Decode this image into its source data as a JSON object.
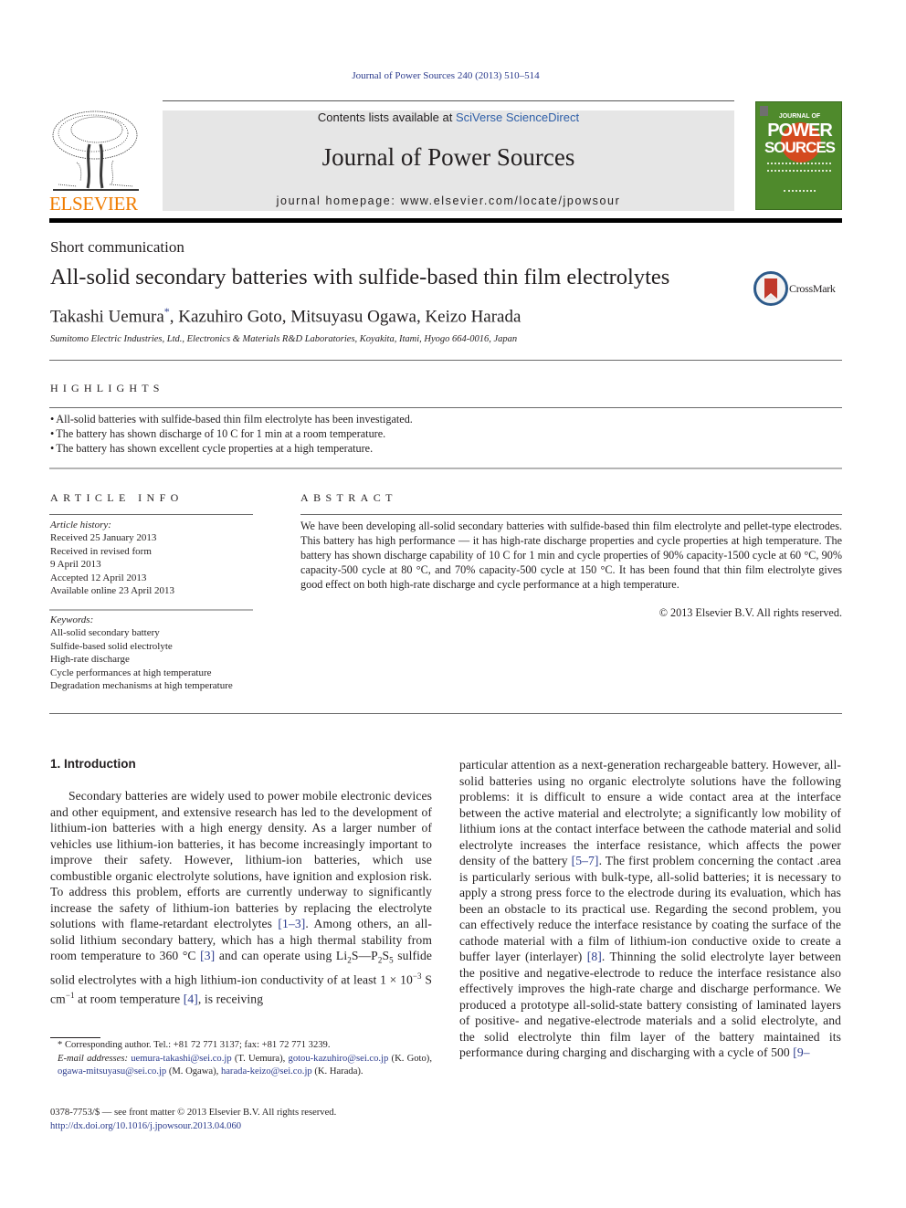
{
  "citation": "Journal of Power Sources 240 (2013) 510–514",
  "header": {
    "publisher_logo_text": "ELSEVIER",
    "contents_prefix": "Contents lists available at ",
    "contents_link": "SciVerse ScienceDirect",
    "journal_title": "Journal of Power Sources",
    "homepage": "journal homepage: www.elsevier.com/locate/jpowsour",
    "cover": {
      "line1": "JOURNAL OF",
      "line2": "POWER",
      "line3": "SOURCES"
    }
  },
  "article": {
    "type": "Short communication",
    "title": "All-solid secondary batteries with sulfide-based thin film electrolytes",
    "crossmark_label": "CrossMark",
    "authors": [
      {
        "name": "Takashi Uemura",
        "mark": "*"
      },
      {
        "name": "Kazuhiro Goto",
        "mark": ""
      },
      {
        "name": "Mitsuyasu Ogawa",
        "mark": ""
      },
      {
        "name": "Keizo Harada",
        "mark": ""
      }
    ],
    "affiliation": "Sumitomo Electric Industries, Ltd., Electronics & Materials R&D Laboratories, Koyakita, Itami, Hyogo 664-0016, Japan"
  },
  "highlights": {
    "heading": "HIGHLIGHTS",
    "items": [
      "All-solid batteries with sulfide-based thin film electrolyte has been investigated.",
      "The battery has shown discharge of 10 C for 1 min at a room temperature.",
      "The battery has shown excellent cycle properties at a high temperature."
    ]
  },
  "article_info": {
    "heading": "ARTICLE INFO",
    "history_label": "Article history:",
    "history": [
      "Received 25 January 2013",
      "Received in revised form",
      "9 April 2013",
      "Accepted 12 April 2013",
      "Available online 23 April 2013"
    ],
    "keywords_label": "Keywords:",
    "keywords": [
      "All-solid secondary battery",
      "Sulfide-based solid electrolyte",
      "High-rate discharge",
      "Cycle performances at high temperature",
      "Degradation mechanisms at high temperature"
    ]
  },
  "abstract": {
    "heading": "ABSTRACT",
    "text": "We have been developing all-solid secondary batteries with sulfide-based thin film electrolyte and pellet-type electrodes. This battery has high performance — it has high-rate discharge properties and cycle properties at high temperature. The battery has shown discharge capability of 10 C for 1 min and cycle properties of 90% capacity-1500 cycle at 60 °C, 90% capacity-500 cycle at 80 °C, and 70% capacity-500 cycle at 150 °C. It has been found that thin film electrolyte gives good effect on both high-rate discharge and cycle performance at a high temperature.",
    "copyright": "© 2013 Elsevier B.V. All rights reserved."
  },
  "body": {
    "section_heading": "1.  Introduction",
    "left": {
      "p1": "Secondary batteries are widely used to power mobile electronic devices and other equipment, and extensive research has led to the development of lithium-ion batteries with a high energy density. As a larger number of vehicles use lithium-ion batteries, it has become increasingly important to improve their safety. However, lithium-ion batteries, which use combustible organic electrolyte solutions, have ignition and explosion risk. To address this problem, efforts are currently underway to significantly increase the safety of lithium-ion batteries by replacing the electrolyte solutions with flame-retardant electrolytes ",
      "ref1": "[1–3]",
      "p2": ". Among others, an all-solid lithium secondary battery, which has a high thermal stability from room temperature to 360 °C ",
      "ref2": "[3]",
      "p3a": " and can operate using Li",
      "sub2a": "2",
      "p3b": "S—P",
      "sub2b": "2",
      "p3c": "S",
      "sub5": "5",
      "p3d": " sulfide solid electrolytes with a high lithium-ion conductivity of at least 1 × 10",
      "sup_m3": "−3",
      "p3e": " S cm",
      "sup_m1": "−1",
      "p3f": " at room temperature ",
      "ref3": "[4]",
      "p4": ", is receiving"
    },
    "right": {
      "p1": "particular attention as a next-generation rechargeable battery. However, all-solid batteries using no organic electrolyte solutions have the following problems: it is difficult to ensure a wide contact area at the interface between the active material and electrolyte; a significantly low mobility of lithium ions at the contact interface between the cathode material and solid electrolyte increases the interface resistance, which affects the power density of the battery ",
      "ref1": "[5–7]",
      "p2": ". The first problem concerning the contact .area is particularly serious with bulk-type, all-solid batteries; it is necessary to apply a strong press force to the electrode during its evaluation, which has been an obstacle to its practical use. Regarding the second problem, you can effectively reduce the interface resistance by coating the surface of the cathode material with a film of lithium-ion conductive oxide to create a buffer layer (interlayer) ",
      "ref2": "[8]",
      "p3": ". Thinning the solid electrolyte layer between the positive and negative-electrode to reduce the interface resistance also effectively improves the high-rate charge and discharge performance. We produced a prototype all-solid-state battery consisting of laminated layers of positive- and negative-electrode materials and a solid electrolyte, and the solid electrolyte thin film layer of the battery maintained its performance during charging and discharging with a cycle of 500 ",
      "ref3": "[9–"
    }
  },
  "footnotes": {
    "corresponding": "* Corresponding author. Tel.: +81 72 771 3137; fax: +81 72 771 3239.",
    "email_label": "E-mail addresses:",
    "emails": [
      {
        "address": "uemura-takashi@sei.co.jp",
        "who": " (T. Uemura), "
      },
      {
        "address": "gotou-kazuhiro@sei.co.jp",
        "who": " (K. Goto), "
      },
      {
        "address": "ogawa-mitsuyasu@sei.co.jp",
        "who": " (M. Ogawa), "
      },
      {
        "address": "harada-keizo@sei.co.jp",
        "who": " (K. Harada)."
      }
    ],
    "front_matter": "0378-7753/$ — see front matter © 2013 Elsevier B.V. All rights reserved.",
    "doi": "http://dx.doi.org/10.1016/j.jpowsour.2013.04.060"
  },
  "colors": {
    "link": "#2a3a8c",
    "elsevier_orange": "#f07c00",
    "banner_bg": "#e6e6e6",
    "cover_green": "#4f8a2c"
  }
}
